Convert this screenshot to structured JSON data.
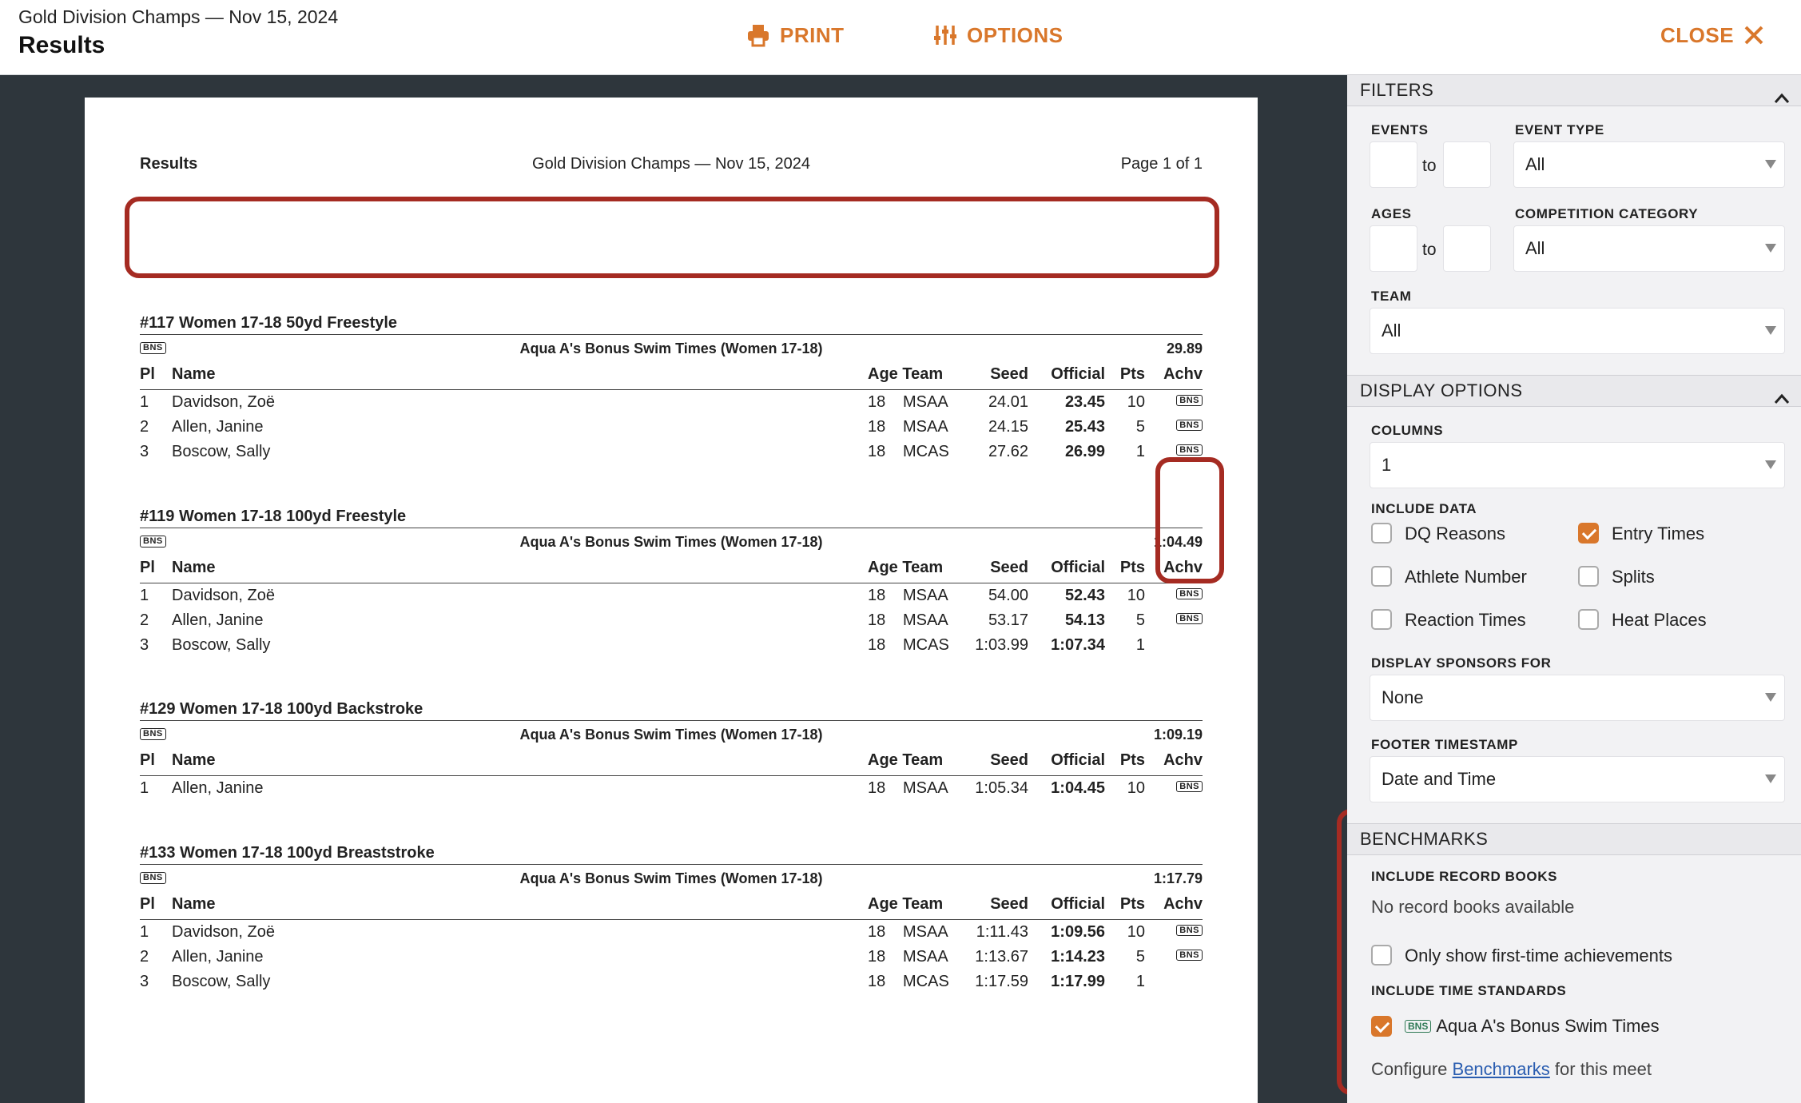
{
  "header": {
    "subtitle": "Gold Division Champs — Nov 15, 2024",
    "title": "Results",
    "print_label": "PRINT",
    "options_label": "OPTIONS",
    "close_label": "CLOSE"
  },
  "doc": {
    "head_left": "Results",
    "head_center": "Gold Division Champs — Nov 15, 2024",
    "head_right": "Page 1 of 1",
    "columns": {
      "pl": "Pl",
      "name": "Name",
      "age_team": "Age Team",
      "seed": "Seed",
      "official": "Official",
      "pts": "Pts",
      "achv": "Achv"
    },
    "badge": "BNS",
    "events": [
      {
        "title": "#117 Women 17-18 50yd Freestyle",
        "standard": "Aqua A's Bonus Swim Times (Women 17-18)",
        "standard_time": "29.89",
        "rows": [
          {
            "pl": "1",
            "name": "Davidson, Zoë",
            "age": "18",
            "team": "MSAA",
            "seed": "24.01",
            "official": "23.45",
            "pts": "10",
            "achv": "BNS"
          },
          {
            "pl": "2",
            "name": "Allen, Janine",
            "age": "18",
            "team": "MSAA",
            "seed": "24.15",
            "official": "25.43",
            "pts": "5",
            "achv": "BNS"
          },
          {
            "pl": "3",
            "name": "Boscow, Sally",
            "age": "18",
            "team": "MCAS",
            "seed": "27.62",
            "official": "26.99",
            "pts": "1",
            "achv": "BNS"
          }
        ]
      },
      {
        "title": "#119 Women 17-18 100yd Freestyle",
        "standard": "Aqua A's Bonus Swim Times (Women 17-18)",
        "standard_time": "1:04.49",
        "rows": [
          {
            "pl": "1",
            "name": "Davidson, Zoë",
            "age": "18",
            "team": "MSAA",
            "seed": "54.00",
            "official": "52.43",
            "pts": "10",
            "achv": "BNS"
          },
          {
            "pl": "2",
            "name": "Allen, Janine",
            "age": "18",
            "team": "MSAA",
            "seed": "53.17",
            "official": "54.13",
            "pts": "5",
            "achv": "BNS"
          },
          {
            "pl": "3",
            "name": "Boscow, Sally",
            "age": "18",
            "team": "MCAS",
            "seed": "1:03.99",
            "official": "1:07.34",
            "pts": "1",
            "achv": ""
          }
        ]
      },
      {
        "title": "#129 Women 17-18 100yd Backstroke",
        "standard": "Aqua A's Bonus Swim Times (Women 17-18)",
        "standard_time": "1:09.19",
        "rows": [
          {
            "pl": "1",
            "name": "Allen, Janine",
            "age": "18",
            "team": "MSAA",
            "seed": "1:05.34",
            "official": "1:04.45",
            "pts": "10",
            "achv": "BNS"
          }
        ]
      },
      {
        "title": "#133 Women 17-18 100yd Breaststroke",
        "standard": "Aqua A's Bonus Swim Times (Women 17-18)",
        "standard_time": "1:17.79",
        "rows": [
          {
            "pl": "1",
            "name": "Davidson, Zoë",
            "age": "18",
            "team": "MSAA",
            "seed": "1:11.43",
            "official": "1:09.56",
            "pts": "10",
            "achv": "BNS"
          },
          {
            "pl": "2",
            "name": "Allen, Janine",
            "age": "18",
            "team": "MSAA",
            "seed": "1:13.67",
            "official": "1:14.23",
            "pts": "5",
            "achv": "BNS"
          },
          {
            "pl": "3",
            "name": "Boscow, Sally",
            "age": "18",
            "team": "MCAS",
            "seed": "1:17.59",
            "official": "1:17.99",
            "pts": "1",
            "achv": ""
          }
        ]
      }
    ]
  },
  "panel": {
    "filters": {
      "heading": "FILTERS",
      "events_label": "EVENTS",
      "to_label": "to",
      "event_type_label": "EVENT TYPE",
      "event_type_value": "All",
      "ages_label": "AGES",
      "competition_label": "COMPETITION CATEGORY",
      "competition_value": "All",
      "team_label": "TEAM",
      "team_value": "All"
    },
    "display": {
      "heading": "DISPLAY OPTIONS",
      "columns_label": "COLUMNS",
      "columns_value": "1",
      "include_data_label": "INCLUDE DATA",
      "options": [
        {
          "label": "DQ Reasons",
          "checked": false
        },
        {
          "label": "Entry Times",
          "checked": true
        },
        {
          "label": "Athlete Number",
          "checked": false
        },
        {
          "label": "Splits",
          "checked": false
        },
        {
          "label": "Reaction Times",
          "checked": false
        },
        {
          "label": "Heat Places",
          "checked": false
        }
      ],
      "sponsors_label": "DISPLAY SPONSORS FOR",
      "sponsors_value": "None",
      "footer_label": "FOOTER TIMESTAMP",
      "footer_value": "Date and Time"
    },
    "benchmarks": {
      "heading": "BENCHMARKS",
      "record_books_label": "INCLUDE RECORD BOOKS",
      "record_books_note": "No record books available",
      "first_time_label": "Only show first-time achievements",
      "first_time_checked": false,
      "time_standards_label": "INCLUDE TIME STANDARDS",
      "standard_badge": "BNS",
      "standard_name": "Aqua A's Bonus Swim Times",
      "standard_checked": true,
      "configure_pre": "Configure",
      "configure_link": "Benchmarks",
      "configure_post": "for this meet"
    }
  },
  "colors": {
    "accent": "#d9772b",
    "annotation": "#a52b22",
    "link": "#2a5db0",
    "page_bg": "#2e363c"
  }
}
